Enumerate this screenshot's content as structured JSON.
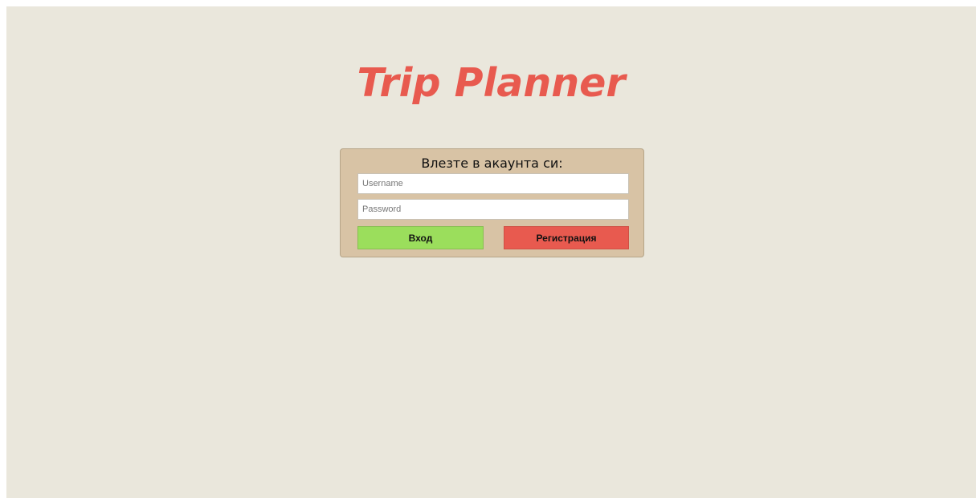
{
  "app": {
    "title": "Trip Planner"
  },
  "login": {
    "heading": "Влезте в акаунта си:",
    "username_placeholder": "Username",
    "password_placeholder": "Password",
    "login_label": "Вход",
    "register_label": "Регистрация"
  },
  "colors": {
    "background": "#eae7dc",
    "panel": "#d8c3a5",
    "title": "#e85a4f",
    "login_button": "#9bde5c",
    "register_button": "#e85a4f"
  }
}
